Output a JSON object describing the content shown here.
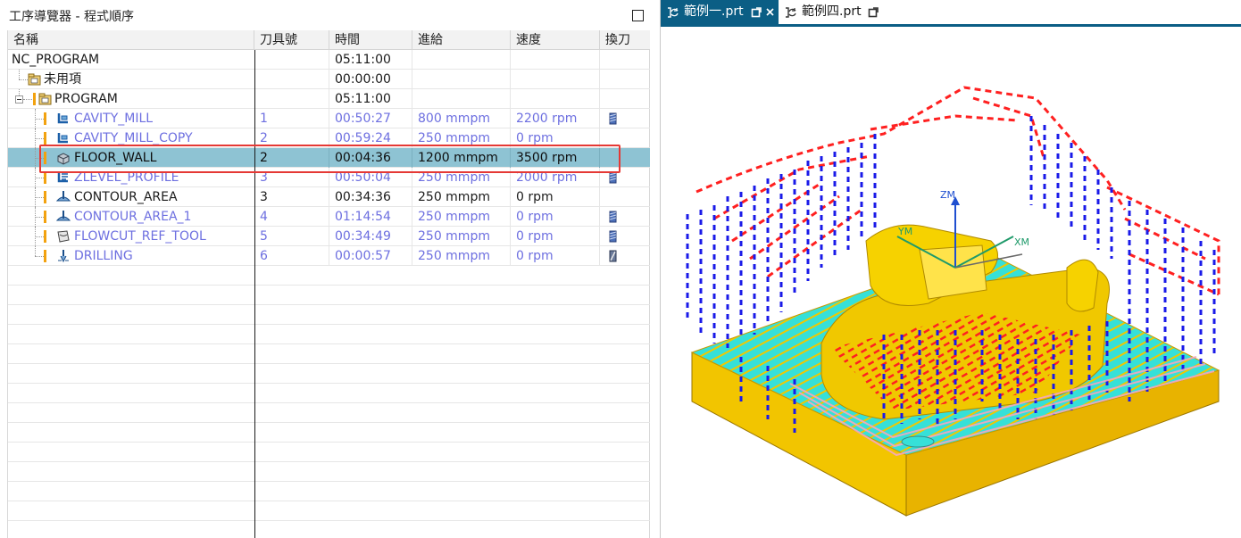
{
  "navigator": {
    "title": "工序導覽器 - 程式順序",
    "columns": {
      "name": "名稱",
      "tool": "刀具號",
      "time": "時間",
      "feed": "進給",
      "speed": "速度",
      "tool_change": "換刀"
    },
    "rows": [
      {
        "name": "NC_PROGRAM",
        "tool": "",
        "time": "05:11:00",
        "feed": "",
        "speed": ""
      },
      {
        "name": "未用項",
        "tool": "",
        "time": "00:00:00",
        "feed": "",
        "speed": ""
      },
      {
        "name": "PROGRAM",
        "tool": "",
        "time": "05:11:00",
        "feed": "",
        "speed": ""
      },
      {
        "name": "CAVITY_MILL",
        "tool": "1",
        "time": "00:50:27",
        "feed": "800 mmpm",
        "speed": "2200 rpm"
      },
      {
        "name": "CAVITY_MILL_COPY",
        "tool": "2",
        "time": "00:59:24",
        "feed": "250 mmpm",
        "speed": "0 rpm"
      },
      {
        "name": "FLOOR_WALL",
        "tool": "2",
        "time": "00:04:36",
        "feed": "1200 mmpm",
        "speed": "3500 rpm"
      },
      {
        "name": "ZLEVEL_PROFILE",
        "tool": "3",
        "time": "00:50:04",
        "feed": "250 mmpm",
        "speed": "2000 rpm"
      },
      {
        "name": "CONTOUR_AREA",
        "tool": "3",
        "time": "00:34:36",
        "feed": "250 mmpm",
        "speed": "0 rpm"
      },
      {
        "name": "CONTOUR_AREA_1",
        "tool": "4",
        "time": "01:14:54",
        "feed": "250 mmpm",
        "speed": "0 rpm"
      },
      {
        "name": "FLOWCUT_REF_TOOL",
        "tool": "5",
        "time": "00:34:49",
        "feed": "250 mmpm",
        "speed": "0 rpm"
      },
      {
        "name": "DRILLING",
        "tool": "6",
        "time": "00:00:57",
        "feed": "250 mmpm",
        "speed": "0 rpm"
      }
    ]
  },
  "tabs": [
    {
      "label": "範例一.prt",
      "active": true
    },
    {
      "label": "範例四.prt",
      "active": false
    }
  ],
  "viewport": {
    "axis_labels": {
      "z": "ZM",
      "y": "YM",
      "x": "XM"
    }
  },
  "colors": {
    "selection": "#8ec3d3",
    "highlight_box": "#e53935",
    "dim_text": "#6d6fe0",
    "tab_active": "#0b5e85",
    "part_gold": "#f0c800",
    "toolpath_cyan": "#36e0d8",
    "toolpath_red": "#ff2020",
    "toolpath_blue": "#1a1ae8"
  },
  "icons": {
    "maximize": "maximize-icon",
    "program_group": "folder-icon",
    "operation": "mill-operation-icon",
    "tool_change": "tool-change-icon",
    "tab_file": "part-file-icon",
    "tab_modified": "modified-icon"
  }
}
